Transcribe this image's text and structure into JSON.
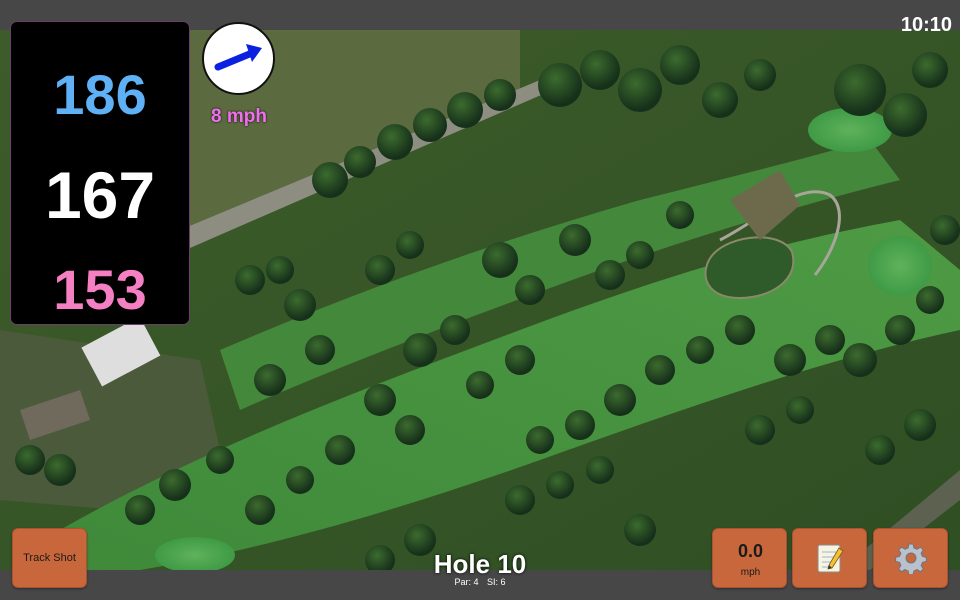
{
  "status": {
    "clock": "10:10"
  },
  "distances": {
    "back": "186",
    "center": "167",
    "front": "153"
  },
  "wind": {
    "speed": "8 mph",
    "direction_icon": "wind-arrow-icon",
    "arrow_color": "#0a22e0"
  },
  "hole": {
    "title": "Hole 10",
    "par": "Par: 4",
    "stroke_index": "SI: 6"
  },
  "buttons": {
    "track_shot": "Track Shot",
    "speed_value": "0.0",
    "speed_unit": "mph",
    "notes_icon": "notepad-icon",
    "settings_icon": "gear-icon"
  },
  "colors": {
    "back_distance": "#5fb0f5",
    "center_distance": "#ffffff",
    "front_distance": "#f57fc3",
    "button": "#c9673c",
    "wind_text": "#f06ef0"
  }
}
